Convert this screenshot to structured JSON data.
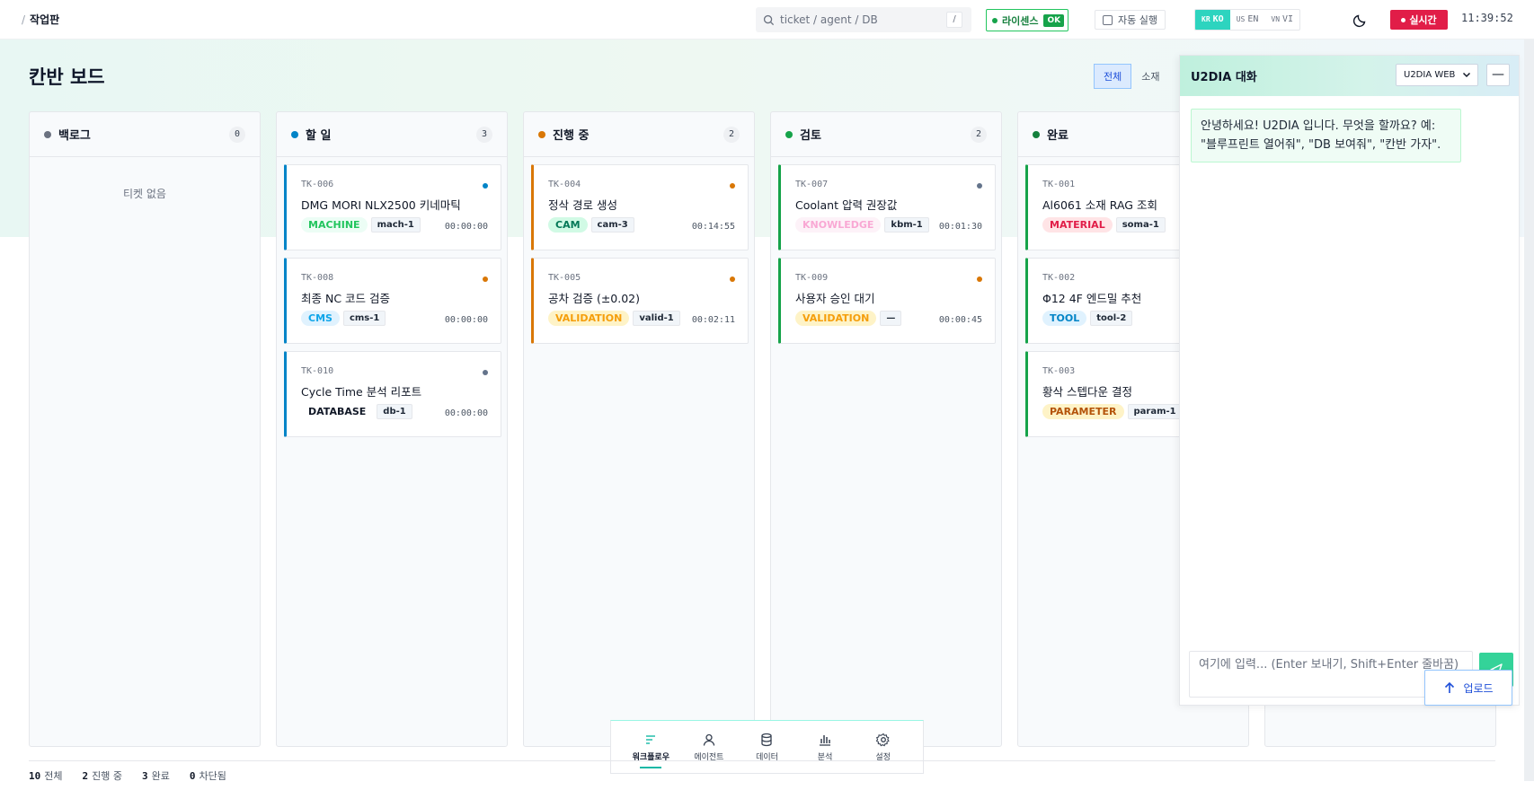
{
  "breadcrumb": {
    "separator": "/",
    "current": "작업판"
  },
  "search": {
    "placeholder": "ticket / agent / DB",
    "shortcut": "/"
  },
  "license": {
    "label": "라이센스",
    "status": "OK"
  },
  "autorun": {
    "label": "자동 실행"
  },
  "languages": [
    {
      "flag": "KR",
      "code": "KO",
      "active": true
    },
    {
      "flag": "US",
      "code": "EN",
      "active": false
    },
    {
      "flag": "VN",
      "code": "VI",
      "active": false
    }
  ],
  "theme_icon": "moon-icon",
  "live": {
    "label": "실시간"
  },
  "clock": "11:39:52",
  "page": {
    "title": "칸반 보드"
  },
  "filters": [
    {
      "label": "전체",
      "active": true
    },
    {
      "label": "소재",
      "active": false
    }
  ],
  "columns": [
    {
      "title": "백로그",
      "count": "0",
      "color": "#6b7280",
      "empty_text": "티켓 없음",
      "cards": []
    },
    {
      "title": "할 일",
      "count": "3",
      "color": "#0284c7",
      "cards": [
        {
          "id": "TK-006",
          "title": "DMG MORI NLX2500 키네마틱",
          "tag": "MACHINE",
          "chip": "mach-1",
          "time": "00:00:00"
        },
        {
          "id": "TK-008",
          "title": "최종 NC 코드 검증",
          "tag": "CMS",
          "chip": "cms-1",
          "time": "00:00:00"
        },
        {
          "id": "TK-010",
          "title": "Cycle Time 분석 리포트",
          "tag": "DATABASE",
          "chip": "db-1",
          "time": "00:00:00"
        }
      ]
    },
    {
      "title": "진행 중",
      "count": "2",
      "color": "#d97706",
      "cards": [
        {
          "id": "TK-004",
          "title": "정삭 경로 생성",
          "tag": "CAM",
          "chip": "cam-3",
          "time": "00:14:55"
        },
        {
          "id": "TK-005",
          "title": "공차 검증 (±0.02)",
          "tag": "VALIDATION",
          "chip": "valid-1",
          "time": "00:02:11"
        }
      ]
    },
    {
      "title": "검토",
      "count": "2",
      "color": "#16a34a",
      "cards": [
        {
          "id": "TK-007",
          "title": "Coolant 압력 권장값",
          "tag": "KNOWLEDGE",
          "chip": "kbm-1",
          "time": "00:01:30"
        },
        {
          "id": "TK-009",
          "title": "사용자 승인 대기",
          "tag": "VALIDATION",
          "chip": "—",
          "time": "00:00:45"
        }
      ]
    },
    {
      "title": "완료",
      "count": "",
      "color": "#15803d",
      "cards": [
        {
          "id": "TK-001",
          "title": "Al6061 소재 RAG 조회",
          "tag": "MATERIAL",
          "chip": "soma-1",
          "time": ""
        },
        {
          "id": "TK-002",
          "title": "Φ12 4F 엔드밀 추천",
          "tag": "TOOL",
          "chip": "tool-2",
          "time": ""
        },
        {
          "id": "TK-003",
          "title": "황삭 스텝다운 결정",
          "tag": "PARAMETER",
          "chip": "param-1",
          "time": ""
        }
      ]
    }
  ],
  "chat": {
    "title": "U2DIA 대화",
    "source": "U2DIA WEB",
    "minimize": "—",
    "message": "안녕하세요! U2DIA 입니다. 무엇을 할까요? 예: \"블루프린트 열어줘\", \"DB 보여줘\", \"칸반 가자\".",
    "input_placeholder": "여기에 입력... (Enter 보내기, Shift+Enter 줄바꿈)"
  },
  "upload": {
    "label": "업로드"
  },
  "bottom_nav": [
    {
      "label": "워크플로우",
      "icon": "workflow-icon",
      "active": true
    },
    {
      "label": "에이전트",
      "icon": "user-icon",
      "active": false
    },
    {
      "label": "데이터",
      "icon": "database-icon",
      "active": false
    },
    {
      "label": "분석",
      "icon": "chart-icon",
      "active": false
    },
    {
      "label": "설정",
      "icon": "gear-icon",
      "active": false
    }
  ],
  "stats": [
    {
      "value": "10",
      "label": "전체"
    },
    {
      "value": "2",
      "label": "진행 중"
    },
    {
      "value": "3",
      "label": "완료"
    },
    {
      "value": "0",
      "label": "차단됨"
    }
  ],
  "colors": {
    "accent": "#14b8a6",
    "live": "#e11d48",
    "license": "#16a34a",
    "todo": "#0284c7",
    "in_progress": "#d97706",
    "review": "#16a34a",
    "done": "#15803d",
    "backlog": "#6b7280"
  }
}
